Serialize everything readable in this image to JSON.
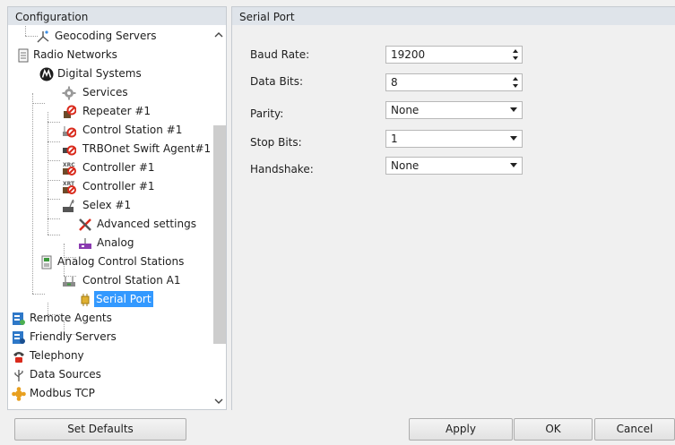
{
  "left_panel": {
    "title": "Configuration"
  },
  "right_panel": {
    "title": "Serial Port"
  },
  "tree": [
    {
      "label": "Geocoding Servers",
      "icon": "geocoding-icon"
    },
    {
      "label": "Radio Networks",
      "icon": "radio-networks-icon"
    },
    {
      "label": "Digital Systems",
      "icon": "motorola-logo-icon"
    },
    {
      "label": "Services",
      "icon": "gear-icon"
    },
    {
      "label": "Repeater #1",
      "icon": "repeater-icon"
    },
    {
      "label": "Control Station #1",
      "icon": "control-station-icon"
    },
    {
      "label": "TRBOnet Swift Agent#1",
      "icon": "swift-agent-icon"
    },
    {
      "label": "Controller #1",
      "icon": "controller-xrc-icon",
      "badge": "XRC"
    },
    {
      "label": "Controller #1",
      "icon": "controller-xrt-icon",
      "badge": "XRT"
    },
    {
      "label": "Selex #1",
      "icon": "selex-icon"
    },
    {
      "label": "Advanced settings",
      "icon": "tools-icon"
    },
    {
      "label": "Analog",
      "icon": "analog-icon"
    },
    {
      "label": "Analog Control Stations",
      "icon": "analog-stations-icon"
    },
    {
      "label": "Control Station A1",
      "icon": "control-station-a1-icon"
    },
    {
      "label": "Serial Port",
      "icon": "serial-port-icon",
      "selected": true
    },
    {
      "label": "Remote Agents",
      "icon": "remote-agents-icon"
    },
    {
      "label": "Friendly Servers",
      "icon": "friendly-servers-icon"
    },
    {
      "label": "Telephony",
      "icon": "telephone-icon"
    },
    {
      "label": "Data Sources",
      "icon": "usb-icon"
    },
    {
      "label": "Modbus TCP",
      "icon": "modbus-icon"
    }
  ],
  "form": {
    "baud_rate": {
      "label": "Baud Rate:",
      "value": "19200",
      "control": "spinner"
    },
    "data_bits": {
      "label": "Data Bits:",
      "value": "8",
      "control": "spinner"
    },
    "parity": {
      "label": "Parity:",
      "value": "None",
      "control": "dropdown"
    },
    "stop_bits": {
      "label": "Stop Bits:",
      "value": "1",
      "control": "dropdown"
    },
    "handshake": {
      "label": "Handshake:",
      "value": "None",
      "control": "dropdown"
    }
  },
  "buttons": {
    "set_defaults": "Set Defaults",
    "apply": "Apply",
    "ok": "OK",
    "cancel": "Cancel"
  },
  "colors": {
    "header_bg": "#dfe4ea",
    "selection": "#3399ff",
    "window_bg": "#f0f0f0"
  }
}
